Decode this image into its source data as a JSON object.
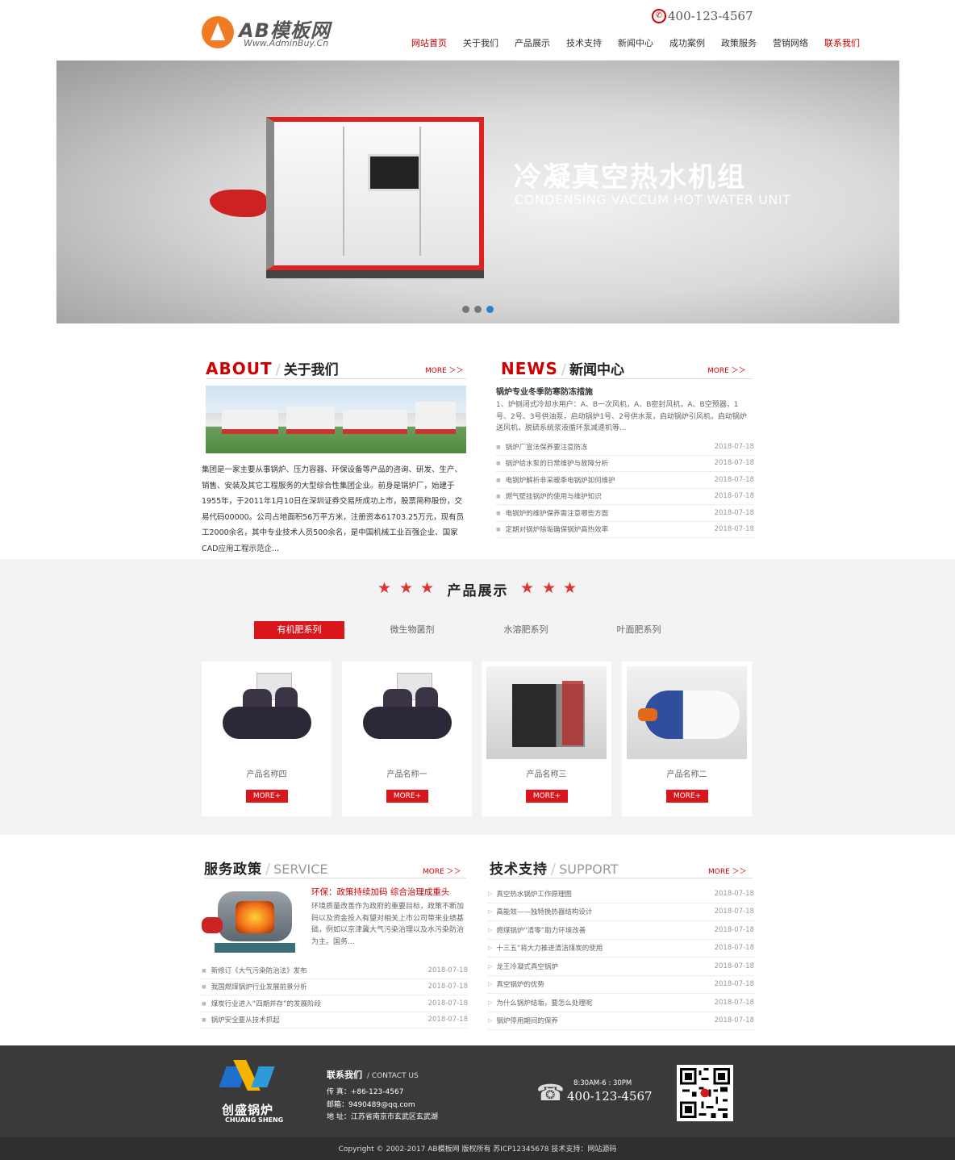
{
  "header": {
    "logo_text": "AB模板网",
    "logo_sub": "Www.AdminBuy.Cn",
    "phone": "400-123-4567",
    "nav": [
      "网站首页",
      "关于我们",
      "产品展示",
      "技术支持",
      "新闻中心",
      "成功案例",
      "政策服务",
      "营销网络",
      "联系我们"
    ]
  },
  "banner": {
    "title": "冷凝真空热水机组",
    "subtitle": "CONDENSING VACCUM HOT WATER UNIT",
    "active_slide": 3,
    "slides": 3
  },
  "about": {
    "en": "ABOUT",
    "cn": "关于我们",
    "more": "MORE ＞＞",
    "text": "集团是一家主要从事锅炉、压力容器、环保设备等产品的咨询、研发、生产、销售、安装及其它工程服务的大型综合性集团企业。前身是锅炉厂，始建于1955年，于2011年1月10日在深圳证券交易所成功上市，股票简称股份，交易代码00000。公司占地面积56万平方米，注册资本61703.25万元，现有员工2000余名，其中专业技术人员500余名，是中国机械工业百强企业、国家CAD应用工程示范企..."
  },
  "news": {
    "en": "NEWS",
    "cn": "新闻中心",
    "more": "MORE ＞＞",
    "headline": "锅炉专业冬季防寒防冻措施",
    "summary": "1、炉侧闭式冷却水用户：A、B一次风机，A、B密封风机，A、B空预器，1号、2号、3号供油泵，启动锅炉1号、2号供水泵，启动锅炉引风机，启动锅炉送风机，脱硫系统浆液循环泵减速机等...",
    "items": [
      {
        "title": "锅炉厂宣法保养要注意防冻",
        "date": "2018-07-18"
      },
      {
        "title": "锅炉给水泵的日常维护与故障分析",
        "date": "2018-07-18"
      },
      {
        "title": "电锅炉解析非采暖季电锅炉如何维护",
        "date": "2018-07-18"
      },
      {
        "title": "燃气壁挂锅炉的使用与维护知识",
        "date": "2018-07-18"
      },
      {
        "title": "电锅炉的维护保养需注意哪些方面",
        "date": "2018-07-18"
      },
      {
        "title": "定期对锅炉除垢确保锅炉高热效率",
        "date": "2018-07-18"
      }
    ]
  },
  "products": {
    "title": "产品展示",
    "tabs": [
      "有机肥系列",
      "微生物菌剂",
      "水溶肥系列",
      "叶面肥系列"
    ],
    "active_tab": 0,
    "items": [
      {
        "name": "产品名称四",
        "btn": "MORE+"
      },
      {
        "name": "产品名称一",
        "btn": "MORE+"
      },
      {
        "name": "产品名称三",
        "btn": "MORE+"
      },
      {
        "name": "产品名称二",
        "btn": "MORE+"
      }
    ]
  },
  "service": {
    "cn": "服务政策",
    "en": "SERVICE",
    "more": "MORE ＞＞",
    "headline": "环保：政策持续加码 综合治理成重头",
    "summary": "环境质量改善作为政府的重要目标，政策不断加码以及资金投入有望对相关上市公司带来业绩基础，例如以京津冀大气污染治理以及水污染防治为主。国务...",
    "items": [
      {
        "title": "新修订《大气污染防治法》发布",
        "date": "2018-07-18"
      },
      {
        "title": "我国燃煤锅炉行业发展前景分析",
        "date": "2018-07-18"
      },
      {
        "title": "煤炭行业进入“四期并存”的发展阶段",
        "date": "2018-07-18"
      },
      {
        "title": "锅炉安全要从技术抓起",
        "date": "2018-07-18"
      }
    ]
  },
  "support": {
    "cn": "技术支持",
    "en": "SUPPORT",
    "more": "MORE ＞＞",
    "items": [
      {
        "title": "真空热水锅炉工作原理图",
        "date": "2018-07-18"
      },
      {
        "title": "高能效——独特换热器结构设计",
        "date": "2018-07-18"
      },
      {
        "title": "燃煤锅炉“清零”助力环境改善",
        "date": "2018-07-18"
      },
      {
        "title": "十三五”将大力推进清洁煤炭的使用",
        "date": "2018-07-18"
      },
      {
        "title": "龙王冷凝式真空锅炉",
        "date": "2018-07-18"
      },
      {
        "title": "真空锅炉的优势",
        "date": "2018-07-18"
      },
      {
        "title": "为什么锅炉结垢，要怎么处理呢",
        "date": "2018-07-18"
      },
      {
        "title": "锅炉停用期间的保养",
        "date": "2018-07-18"
      }
    ]
  },
  "footer": {
    "brand": "创盛锅炉",
    "brand_en": "CHUANG SHENG",
    "contact_title": "联系我们",
    "contact_en": "/ CONTACT US",
    "fax": "传 真：+86-123-4567",
    "email": "邮箱：9490489@qq.com",
    "address": "地 址：江苏省南京市玄武区玄武湖",
    "hours": "8:30AM-6 : 30PM",
    "phone": "400-123-4567",
    "copyright": "Copyright © 2002-2017 AB模板网 版权所有   苏ICP12345678   技术支持：网站源码"
  },
  "colors": {
    "accent": "#d8161b",
    "footer": "#3a3a3a"
  }
}
